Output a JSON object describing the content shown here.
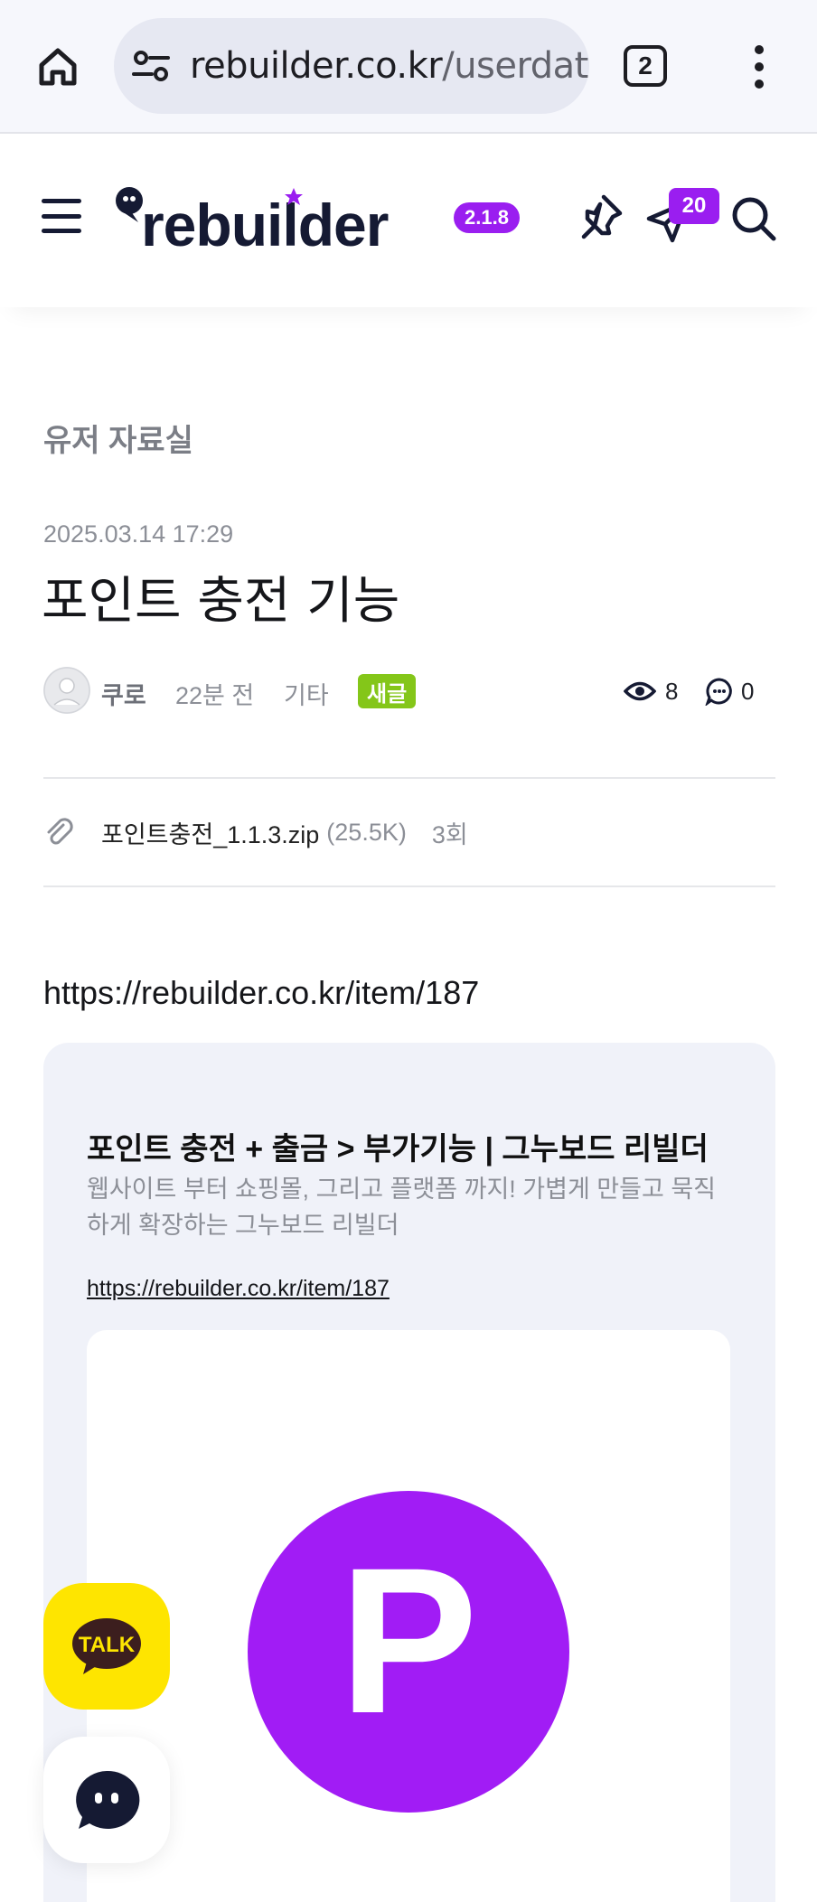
{
  "browser": {
    "url_host": "rebuilder.co.kr",
    "url_path": "/userdat",
    "tab_count": "2",
    "icons": {
      "home": "home-icon",
      "site_settings": "tune-icon",
      "menu": "more-vert-icon"
    }
  },
  "header": {
    "logo_text": "rebuilder",
    "version": "2.1.8",
    "notification_count": "20",
    "colors": {
      "brand_navy": "#151a33",
      "accent_purple": "#9a1ef0"
    },
    "icons": {
      "menu": "hamburger-icon",
      "pin": "pin-icon",
      "send": "send-icon",
      "search": "search-icon"
    }
  },
  "post": {
    "board_name": "유저 자료실",
    "date": "2025.03.14 17:29",
    "title": "포인트 충전 기능",
    "author": "쿠로",
    "time_ago": "22분 전",
    "category": "기타",
    "new_badge": "새글",
    "views": "8",
    "comments": "0",
    "new_badge_color": "#84c619"
  },
  "attachment": {
    "file_name": "포인트충전_1.1.3.zip",
    "file_size": "(25.5K)",
    "download_count": "3회"
  },
  "body": {
    "link": "https://rebuilder.co.kr/item/187"
  },
  "preview": {
    "title": "포인트 충전 + 출금 > 부가기능 | 그누보드 리빌더",
    "description": "웹사이트 부터 쇼핑몰, 그리고 플랫폼 까지! 가볍게 만들고 묵직하게 확장하는 그누보드 리빌더",
    "url": "https://rebuilder.co.kr/item/187",
    "logo_letter": "P",
    "logo_color": "#a11cf5"
  },
  "floating": {
    "kakao_label": "TALK",
    "kakao_color": "#fee500"
  }
}
